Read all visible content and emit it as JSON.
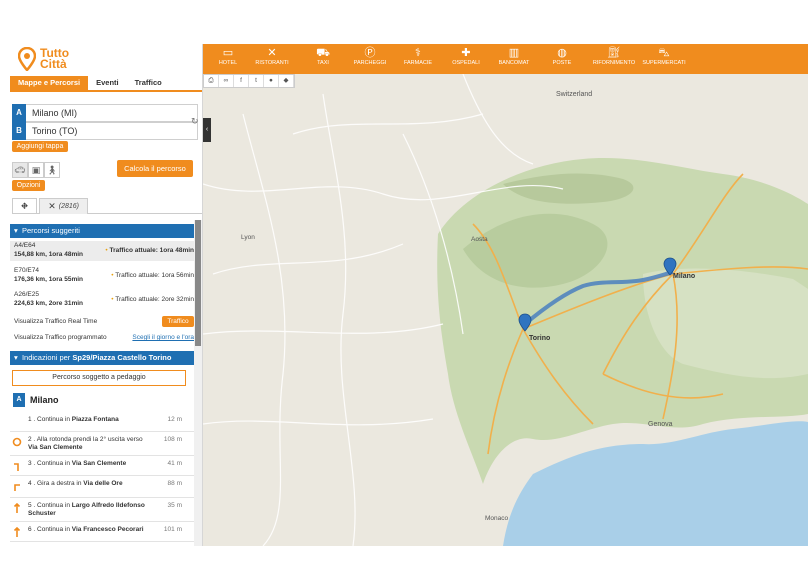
{
  "app": {
    "logo_line1": "Tutto",
    "logo_line2": "Città"
  },
  "tabs": [
    {
      "label": "Mappe e Percorsi"
    },
    {
      "label": "Eventi"
    },
    {
      "label": "Traffico"
    }
  ],
  "route": {
    "from_letter": "A",
    "from_value": "Milano (MI)",
    "to_letter": "B",
    "to_value": "Torino (TO)",
    "add_stop": "Aggiungi tappa",
    "options": "Opzioni",
    "calc": "Calcola il percorso"
  },
  "subtabs": {
    "pois_count": "(2816)"
  },
  "suggested": {
    "header": "Percorsi suggeriti",
    "routes": [
      {
        "name": "A4/E64",
        "km": "154,88 km, 1ora 48min",
        "traffic": "Traffico attuale: 1ora 48min"
      },
      {
        "name": "E70/E74",
        "km": "176,36 km, 1ora 55min",
        "traffic": "Traffico attuale: 1ora 56min"
      },
      {
        "name": "A26/E25",
        "km": "224,63 km, 2ore 31min",
        "traffic": "Traffico attuale: 2ore 32min"
      }
    ],
    "realtime_label": "Visualizza Traffico Real Time",
    "realtime_button": "Traffico",
    "scheduled_label": "Visualizza Traffico programmato",
    "scheduled_link": "Scegli il giorno e l'ora"
  },
  "directions": {
    "header_prefix": "Indicazioni per ",
    "header_dest": "Sp29/Piazza Castello Torino",
    "toll_notice": "Percorso soggetto a pedaggio",
    "start_letter": "A",
    "start_name": "Milano",
    "steps": [
      {
        "num": "1 .",
        "text": "Continua in ",
        "bold": "Piazza Fontana",
        "dist": "12 m"
      },
      {
        "num": "2 .",
        "text": "Alla rotonda prendi la 2° uscita verso ",
        "bold": "Via San Clemente",
        "dist": "108 m"
      },
      {
        "num": "3 .",
        "text": "Continua in ",
        "bold": "Via San Clemente",
        "dist": "41 m"
      },
      {
        "num": "4 .",
        "text": "Gira a destra in ",
        "bold": "Via delle Ore",
        "dist": "88 m"
      },
      {
        "num": "5 .",
        "text": "Continua in ",
        "bold": "Largo Alfredo Ildefonso Schuster",
        "dist": "35 m"
      },
      {
        "num": "6 .",
        "text": "Continua in ",
        "bold": "Via Francesco Pecorari",
        "dist": "101 m"
      }
    ]
  },
  "poi_bar": [
    {
      "label": "HOTEL",
      "icon": "bed-icon"
    },
    {
      "label": "RISTORANTI",
      "icon": "cutlery-icon"
    },
    {
      "label": "TAXI",
      "icon": "taxi-icon"
    },
    {
      "label": "PARCHEGGI",
      "icon": "parking-icon"
    },
    {
      "label": "FARMACIE",
      "icon": "pharmacy-icon"
    },
    {
      "label": "OSPEDALI",
      "icon": "ambulance-icon"
    },
    {
      "label": "BANCOMAT",
      "icon": "atm-icon"
    },
    {
      "label": "POSTE",
      "icon": "globe-icon"
    },
    {
      "label": "RIFORNIMENTO",
      "icon": "fuel-icon"
    },
    {
      "label": "SUPERMERCATI",
      "icon": "cart-icon"
    }
  ],
  "map_labels": {
    "switzerland": "Switzerland",
    "aosta": "Aosta",
    "lyon": "Lyon",
    "milano": "Milano",
    "torino": "Torino",
    "genova": "Genova",
    "monaco": "Monaco"
  },
  "colors": {
    "accent": "#f08c1e",
    "blue": "#1f6fb2",
    "route": "#4a7fc0"
  }
}
